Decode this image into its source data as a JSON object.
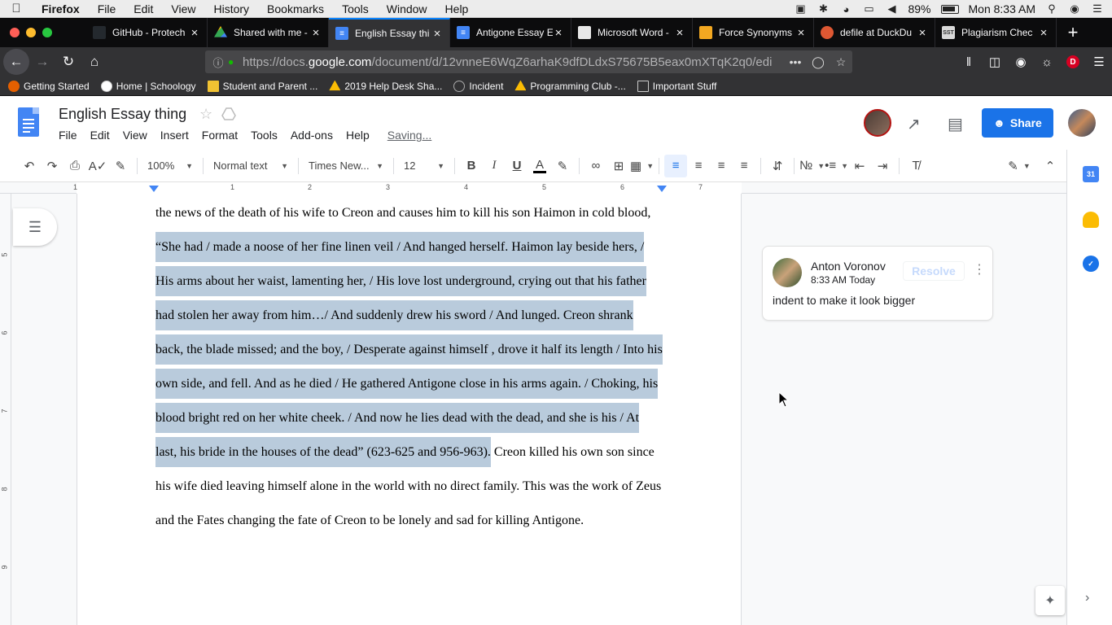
{
  "mac_menubar": {
    "app": "Firefox",
    "items": [
      "File",
      "Edit",
      "View",
      "History",
      "Bookmarks",
      "Tools",
      "Window",
      "Help"
    ],
    "battery": "89%",
    "clock": "Mon 8:33 AM"
  },
  "tabs": [
    {
      "label": "GitHub - Protech",
      "icon": "github-icon",
      "color": "#24292e"
    },
    {
      "label": "Shared with me -",
      "icon": "google-drive-icon",
      "color": "#fbbc04"
    },
    {
      "label": "English Essay thi",
      "icon": "google-docs-icon",
      "color": "#4285f4"
    },
    {
      "label": "Antigone Essay E",
      "icon": "google-docs-icon",
      "color": "#4285f4"
    },
    {
      "label": "Microsoft Word -",
      "icon": "blank-page-icon",
      "color": "#e8e8e8"
    },
    {
      "label": "Force Synonyms",
      "icon": "thesaurus-icon",
      "color": "#f3a821"
    },
    {
      "label": "defile at DuckDu",
      "icon": "duckduckgo-icon",
      "color": "#de5833"
    },
    {
      "label": "Plagiarism Chec",
      "icon": "sst-icon",
      "color": "#d9d9d9"
    }
  ],
  "address_bar": {
    "prefix": "https://docs.",
    "host": "google.com",
    "path": "/document/d/12vnneE6WqZ6arhaK9dfDLdxS75675B5eax0mXTqK2q0/edi"
  },
  "bookmarks": [
    {
      "label": "Getting Started",
      "icon": "firefox-icon",
      "color": "#e66000"
    },
    {
      "label": "Home | Schoology",
      "icon": "schoology-icon",
      "color": "#ffffff"
    },
    {
      "label": "Student and Parent ...",
      "icon": "flag-icon",
      "color": "#f1c232"
    },
    {
      "label": "2019 Help Desk Sha...",
      "icon": "google-drive-icon",
      "color": "#fbbc04"
    },
    {
      "label": "Incident",
      "icon": "globe-icon",
      "color": "#aaaaaa"
    },
    {
      "label": "Programming Club -...",
      "icon": "google-drive-icon",
      "color": "#fbbc04"
    },
    {
      "label": "Important Stuff",
      "icon": "folder-icon",
      "color": "#cccccc"
    }
  ],
  "docs": {
    "title": "English Essay thing",
    "menu": [
      "File",
      "Edit",
      "View",
      "Insert",
      "Format",
      "Tools",
      "Add-ons",
      "Help"
    ],
    "status": "Saving...",
    "share_label": "Share"
  },
  "toolbar": {
    "zoom": "100%",
    "style": "Normal text",
    "font": "Times New...",
    "size": "12",
    "bold": "B",
    "italic": "I",
    "underline": "U",
    "text_color": "A"
  },
  "ruler": {
    "numbers": [
      "1",
      "1",
      "2",
      "3",
      "4",
      "5",
      "6",
      "7"
    ],
    "vertical": [
      "5",
      "6",
      "7",
      "8",
      "9"
    ]
  },
  "document": {
    "lines": [
      {
        "hl": "",
        "plain": "the news of the death of his wife to Creon and causes him to kill his son Haimon in cold blood,"
      },
      {
        "hl": "“She had / made a noose of her fine linen veil / And hanged herself. Haimon lay beside hers, /",
        "plain": ""
      },
      {
        "hl": "His arms about her waist, lamenting her, / His love lost underground, crying out that his father",
        "plain": ""
      },
      {
        "hl": "had stolen her away from him…/ And suddenly drew his sword / And lunged. Creon shrank",
        "plain": ""
      },
      {
        "hl": "back, the blade missed; and the boy, / Desperate against himself , drove it half its length / Into his",
        "plain": ""
      },
      {
        "hl": "own side, and fell. And as he died / He gathered Antigone close in his arms again. / Choking, his",
        "plain": ""
      },
      {
        "hl": "blood bright red on her white cheek. / And now he lies dead with the dead, and she is his / At",
        "plain": ""
      },
      {
        "hl": "last, his bride in the houses of the dead” (623-625 and 956-963).",
        "plain": " Creon killed his own son since"
      },
      {
        "hl": "",
        "plain": "his wife died leaving himself alone in the world with no direct family. This was the work of Zeus"
      },
      {
        "hl": "",
        "plain": "and the Fates changing the fate of Creon to be lonely and sad for killing Antigone."
      }
    ]
  },
  "comment": {
    "author": "Anton Voronov",
    "time": "8:33 AM Today",
    "resolve_label": "Resolve",
    "text": "indent to make it look bigger"
  },
  "colors": {
    "accent": "#1a73e8",
    "selection": "#b9cbdc",
    "firefox_dark": "#0c0c0d",
    "firefox_toolbar": "#323234"
  }
}
